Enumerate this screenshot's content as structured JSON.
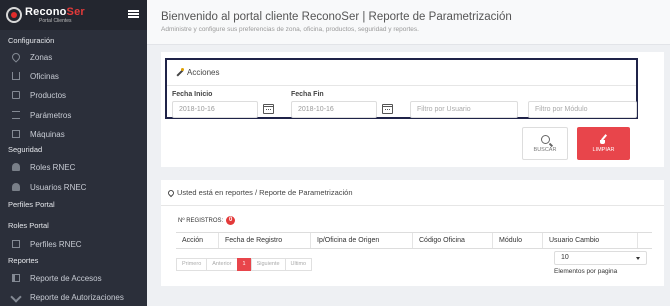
{
  "brand": {
    "name_part1": "Recono",
    "name_part2": "Ser",
    "subtitle": "Portal Clientes"
  },
  "sidebar": {
    "sections": {
      "configuracion": "Configuración",
      "seguridad": "Seguridad",
      "perfiles_portal": "Perfiles Portal",
      "roles_portal": "Roles Portal",
      "reportes": "Reportes"
    },
    "items": [
      {
        "label": "Zonas",
        "icon": "map-marker-icon"
      },
      {
        "label": "Oficinas",
        "icon": "home-icon"
      },
      {
        "label": "Productos",
        "icon": "credit-card-icon"
      },
      {
        "label": "Parámetros",
        "icon": "list-icon"
      },
      {
        "label": "Máquinas",
        "icon": "monitor-icon"
      },
      {
        "label": "Roles RNEC",
        "icon": "users-icon"
      },
      {
        "label": "Usuarios RNEC",
        "icon": "users-icon"
      },
      {
        "label": "Perfiles RNEC",
        "icon": "file-icon"
      },
      {
        "label": "Reporte de Accesos",
        "icon": "book-icon"
      },
      {
        "label": "Reporte de Autorizaciones",
        "icon": "check-icon"
      }
    ]
  },
  "header": {
    "title": "Bienvenido al portal cliente ReconoSer | Reporte de Parametrización",
    "subtitle": "Administre y configure sus preferencias de zona, oficina, productos, seguridad y reportes."
  },
  "actions": {
    "title": "Acciones",
    "fecha_inicio_label": "Fecha Inicio",
    "fecha_inicio_value": "2018-10-16",
    "fecha_fin_label": "Fecha Fin",
    "fecha_fin_value": "2018-10-16",
    "usuario_placeholder": "Filtro por Usuario",
    "modulo_placeholder": "Filtro por Módulo",
    "buscar_label": "BUSCAR",
    "limpiar_label": "LIMPIAR"
  },
  "report": {
    "title": "Usted está en reportes / Reporte de Parametrización",
    "registros_label": "Nº REGISTROS:",
    "registros_count": "0",
    "columns": [
      "Acción",
      "Fecha de Registro",
      "Ip/Oficina de Origen",
      "Código Oficina",
      "Módulo",
      "Usuario Cambio"
    ],
    "pager": {
      "first": "Primero",
      "prev": "Anterior",
      "current": "1",
      "next": "Siguiente",
      "last": "Ultimo"
    },
    "per_page_value": "10",
    "per_page_label": "Elementos por pagina"
  },
  "colors": {
    "sidebar_bg": "#2b2f3a",
    "accent_red": "#e8454b",
    "acciones_border": "#1f2348"
  }
}
